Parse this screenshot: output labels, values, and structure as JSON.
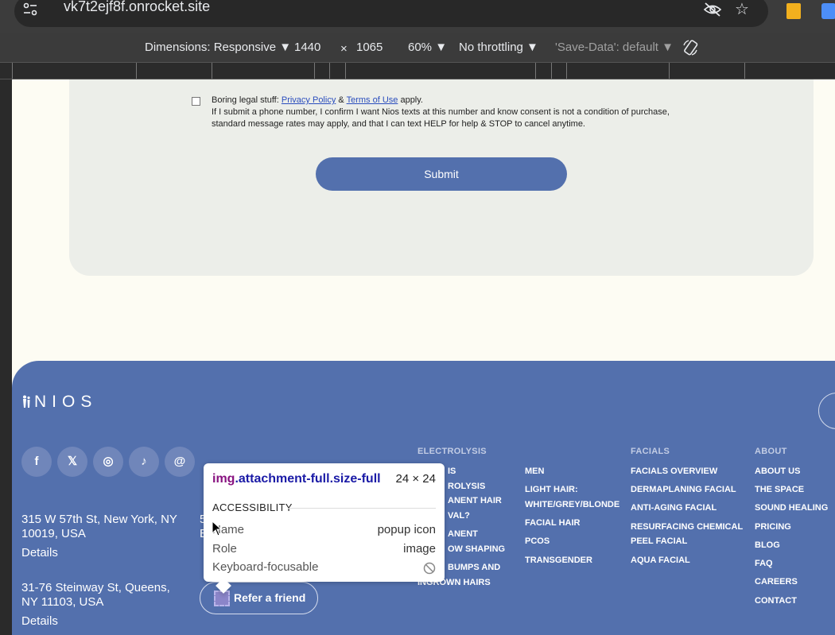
{
  "browser": {
    "url": "vk7t2ejf8f.onrocket.site"
  },
  "devtools": {
    "dimensions": "Dimensions: Responsive ▼",
    "width": "1440",
    "times": "×",
    "height": "1065",
    "zoom": "60% ▼",
    "throttling": "No throttling ▼",
    "save_data": "'Save-Data': default ▼"
  },
  "form": {
    "legal_prefix": "Boring legal stuff:",
    "privacy_link": "Privacy Policy",
    "amp": "&",
    "terms_link": "Terms of Use",
    "legal_suffix": "apply.",
    "legal_line2": "If I submit a phone number, I confirm I want Nios texts at this number and know consent is not a condition of purchase,",
    "legal_line3": "standard message rates may apply, and that I can text HELP for help & STOP to cancel anytime.",
    "submit_label": "Submit"
  },
  "footer": {
    "logo_text": "NIOS",
    "socials": [
      {
        "icon": "facebook-icon",
        "glyph": "f"
      },
      {
        "icon": "x-icon",
        "glyph": "𝕏"
      },
      {
        "icon": "instagram-icon",
        "glyph": "◎"
      },
      {
        "icon": "tiktok-icon",
        "glyph": "♪"
      },
      {
        "icon": "threads-icon",
        "glyph": "@"
      }
    ],
    "address1_line1": "315 W 57th St, New York, NY",
    "address1_line2": "10019, USA",
    "address1_details": "Details",
    "address2_line1": "31-76 Steinway St, Queens,",
    "address2_line2": "NY 11103, USA",
    "address2_details": "Details",
    "address3_partial": "5",
    "address3_partial2": "E",
    "refer_label": "Refer a friend",
    "electrolysis_head": "ELECTROLYSIS",
    "electrolysis_items": [
      "IS",
      "ROLYSIS",
      "ANENT HAIR",
      "VAL?",
      "ANENT",
      "OW SHAPING",
      "BUMPS AND",
      "INGROWN HAIRS"
    ],
    "col2_items": [
      "MEN",
      "LIGHT HAIR:",
      "WHITE/GREY/BLONDE",
      "FACIAL HAIR",
      "PCOS",
      "TRANSGENDER"
    ],
    "facials_head": "FACIALS",
    "facials_items": [
      "FACIALS OVERVIEW",
      "DERMAPLANING FACIAL",
      "ANTI-AGING FACIAL",
      "RESURFACING CHEMICAL",
      "PEEL FACIAL",
      "AQUA FACIAL"
    ],
    "about_head": "ABOUT",
    "about_items": [
      "ABOUT US",
      "THE SPACE",
      "SOUND HEALING",
      "PRICING",
      "BLOG",
      "FAQ",
      "CAREERS",
      "CONTACT"
    ]
  },
  "tooltip": {
    "tag": "img",
    "classes": ".attachment-full.size-full",
    "size": "24 × 24",
    "section": "ACCESSIBILITY",
    "name_key": "Name",
    "name_val": "popup icon",
    "role_key": "Role",
    "role_val": "image",
    "focus_key": "Keyboard-focusable"
  }
}
